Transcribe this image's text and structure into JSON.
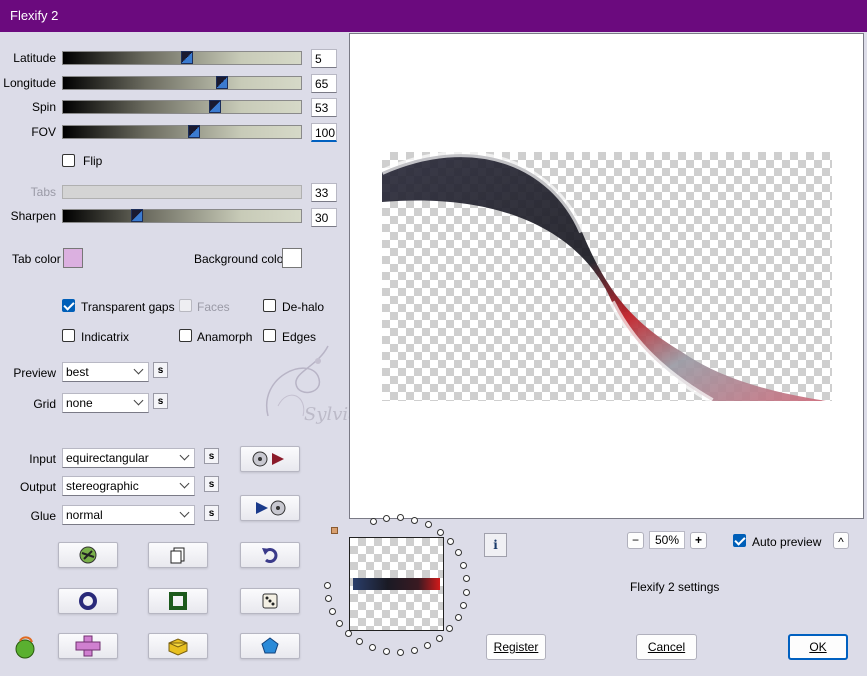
{
  "window": {
    "title": "Flexify 2"
  },
  "sliders": [
    {
      "label": "Latitude",
      "value": "5",
      "fraction": 0.52,
      "disabled": false
    },
    {
      "label": "Longitude",
      "value": "65",
      "fraction": 0.67,
      "disabled": false
    },
    {
      "label": "Spin",
      "value": "53",
      "fraction": 0.64,
      "disabled": false
    },
    {
      "label": "FOV",
      "value": "100",
      "fraction": 0.55,
      "disabled": false
    },
    {
      "label": "Tabs",
      "value": "33",
      "fraction": 0,
      "disabled": true
    },
    {
      "label": "Sharpen",
      "value": "30",
      "fraction": 0.31,
      "disabled": false
    }
  ],
  "flip": {
    "label": "Flip",
    "checked": false
  },
  "colors": {
    "tab_color_label": "Tab color",
    "tab_color": "#dbb0e0",
    "background_color_label": "Background color",
    "background_color": "#ffffff",
    "accent": "#005fb8",
    "titlebar": "#6b0a7e"
  },
  "options": {
    "transparent_gaps": {
      "label": "Transparent gaps",
      "checked": true
    },
    "faces": {
      "label": "Faces",
      "checked": false,
      "disabled": true
    },
    "de_halo": {
      "label": "De-halo",
      "checked": false
    },
    "indicatrix": {
      "label": "Indicatrix",
      "checked": false
    },
    "anamorph": {
      "label": "Anamorph",
      "checked": false
    },
    "edges": {
      "label": "Edges",
      "checked": false
    }
  },
  "dropdowns": {
    "preview": {
      "label": "Preview",
      "value": "best"
    },
    "grid": {
      "label": "Grid",
      "value": "none"
    },
    "input": {
      "label": "Input",
      "value": "equirectangular"
    },
    "output": {
      "label": "Output",
      "value": "stereographic"
    },
    "glue": {
      "label": "Glue",
      "value": "normal"
    }
  },
  "small_button_glyph": "s",
  "watermark": "Sylviane",
  "icons": {
    "convert_forward": "disc-to-arrow-icon",
    "convert_backward": "arrow-to-disc-icon",
    "grid_buttons": [
      "globe-tool-icon",
      "copy-icon",
      "undo-icon",
      "ring-icon",
      "square-frame-icon",
      "dice-icon",
      "cross-icon",
      "cube-icon",
      "pentagon-icon"
    ],
    "logo": "flexify-logo-icon"
  },
  "zoom": {
    "value": "50%",
    "minus": "−",
    "plus": "+"
  },
  "auto_preview": {
    "label": "Auto preview",
    "checked": true
  },
  "collapse_glyph": "^",
  "settings_label": "Flexify 2 settings",
  "info_glyph": "i",
  "buttons": {
    "register": "Register",
    "cancel": "Cancel",
    "ok": "OK"
  }
}
